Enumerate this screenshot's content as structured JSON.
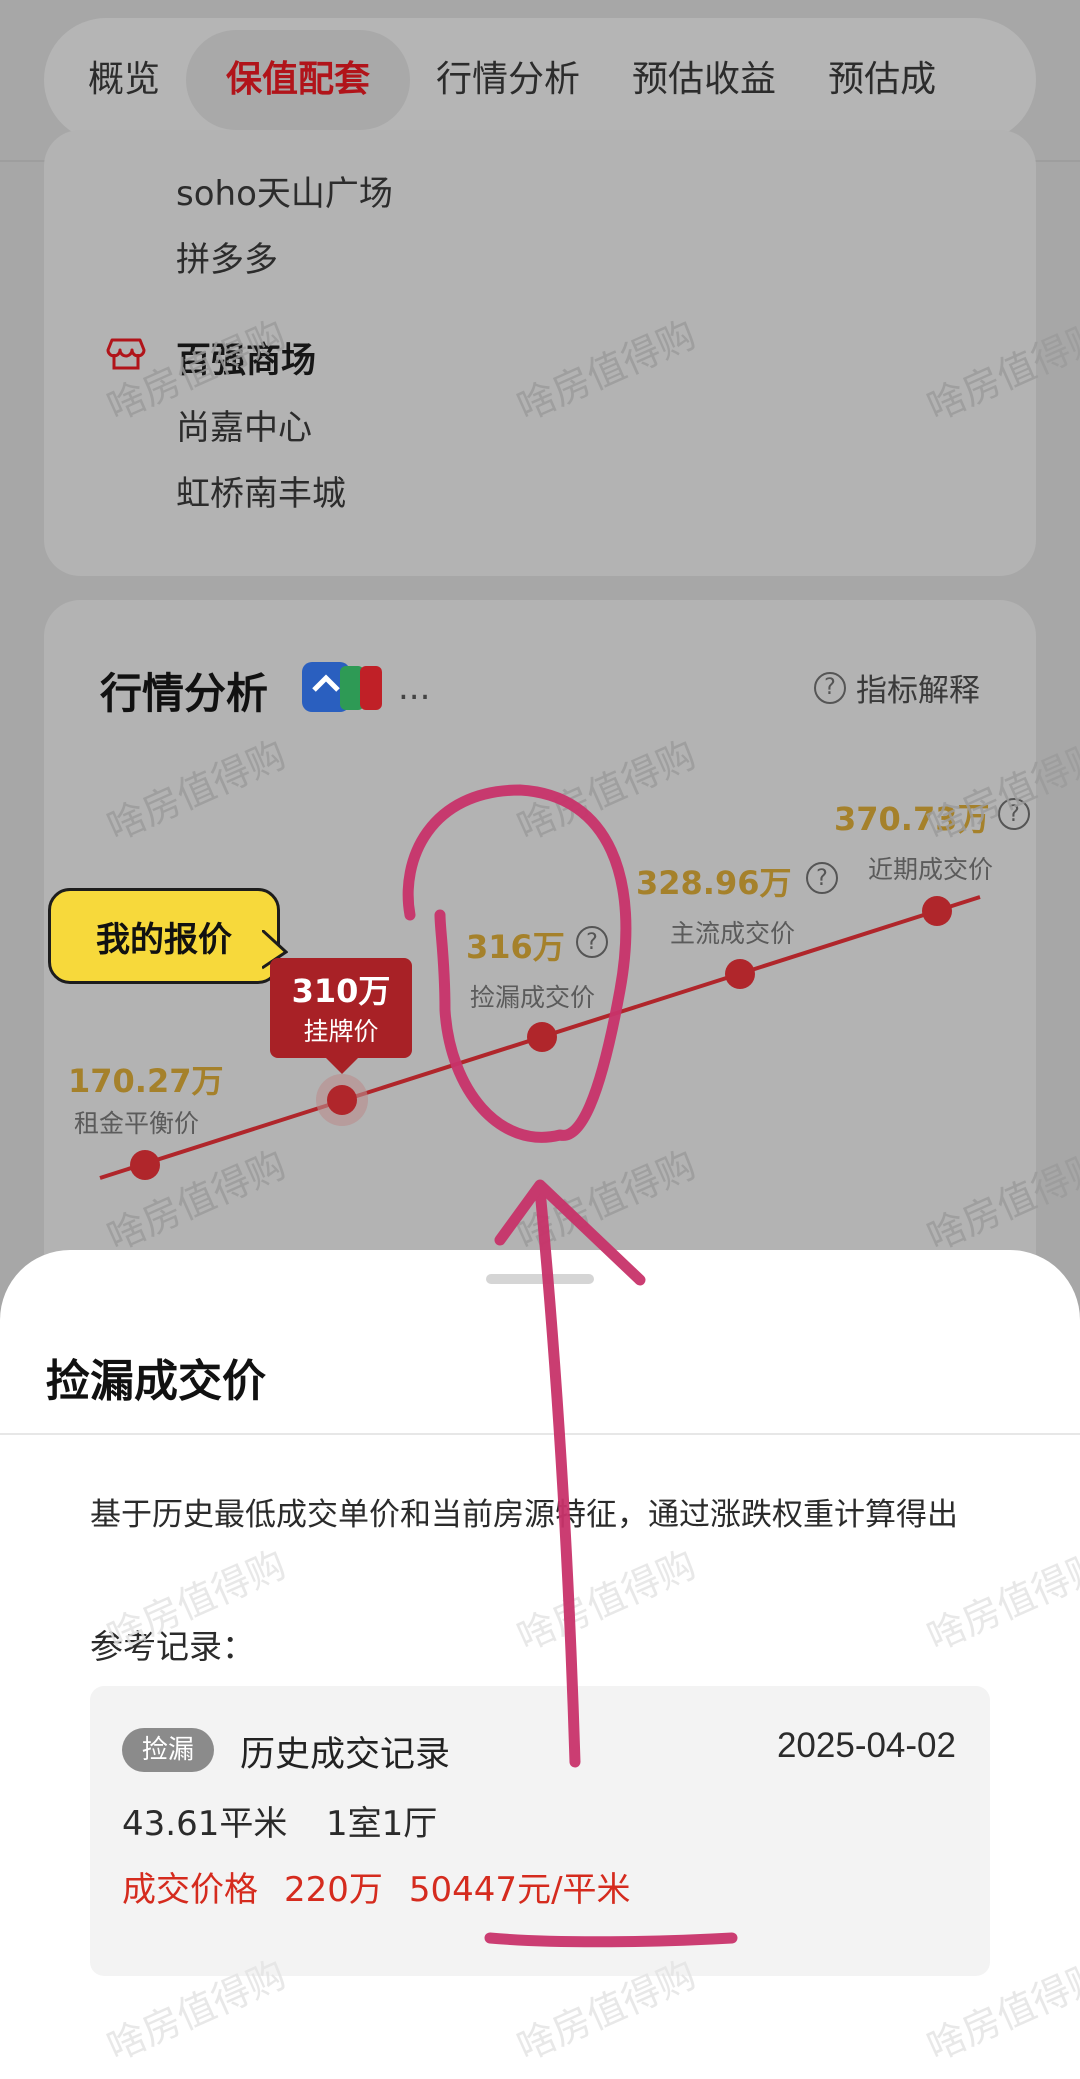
{
  "tabs": [
    "概览",
    "保值配套",
    "行情分析",
    "预估收益",
    "预估成"
  ],
  "active_tab": "保值配套",
  "amenities": {
    "offices": [
      "soho天山广场",
      "拼多多"
    ],
    "mall_category": "百强商场",
    "malls": [
      "尚嘉中心",
      "虹桥南丰城"
    ]
  },
  "market": {
    "title": "行情分析",
    "more": "...",
    "help": "指标解释",
    "my_quote": "我的报价",
    "listing": {
      "value": "310万",
      "label": "挂牌价"
    },
    "points": [
      {
        "value": "170.27万",
        "label": "租金平衡价"
      },
      {
        "value": "316万",
        "label": "捡漏成交价"
      },
      {
        "value": "328.96万",
        "label": "主流成交价"
      },
      {
        "value": "370.73万",
        "label": "近期成交价"
      }
    ]
  },
  "sheet": {
    "title": "捡漏成交价",
    "description": "基于历史最低成交单价和当前房源特征，通过涨跌权重计算得出",
    "ref_label": "参考记录：",
    "record": {
      "badge": "捡漏",
      "title": "历史成交记录",
      "date": "2025-04-02",
      "area": "43.61平米",
      "layout": "1室1厅",
      "price_label": "成交价格",
      "price": "220万",
      "unit_price": "50447元/平米"
    }
  },
  "watermark": "啥房值得购",
  "colors": {
    "accent": "#b1141a",
    "gold": "#a5812b",
    "price_red": "#d52b1e",
    "annotation": "#c8336a"
  }
}
